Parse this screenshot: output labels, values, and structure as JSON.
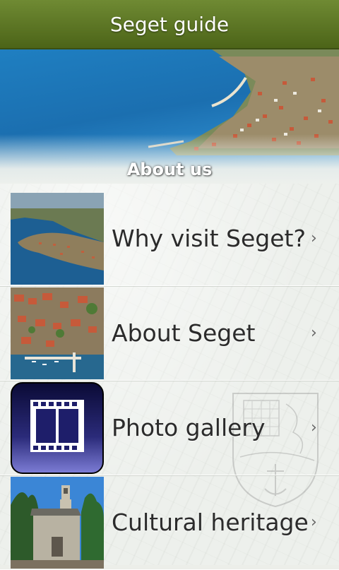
{
  "app": {
    "title": "Seget guide"
  },
  "section": {
    "title": "About us"
  },
  "menu": {
    "items": [
      {
        "label": "Why visit Seget?",
        "chevron": "›"
      },
      {
        "label": "About Seget",
        "chevron": "›"
      },
      {
        "label": "Photo gallery",
        "chevron": "›"
      },
      {
        "label": "Cultural heritage",
        "chevron": "›"
      }
    ]
  },
  "colors": {
    "titlebar": "#5a7421",
    "sea": "#1b6fb0",
    "text": "#2b2b2b"
  },
  "icons": [
    "aerial-coast-photo",
    "harbor-photo",
    "film-strip-icon",
    "chapel-photo",
    "coat-of-arms-watermark"
  ]
}
